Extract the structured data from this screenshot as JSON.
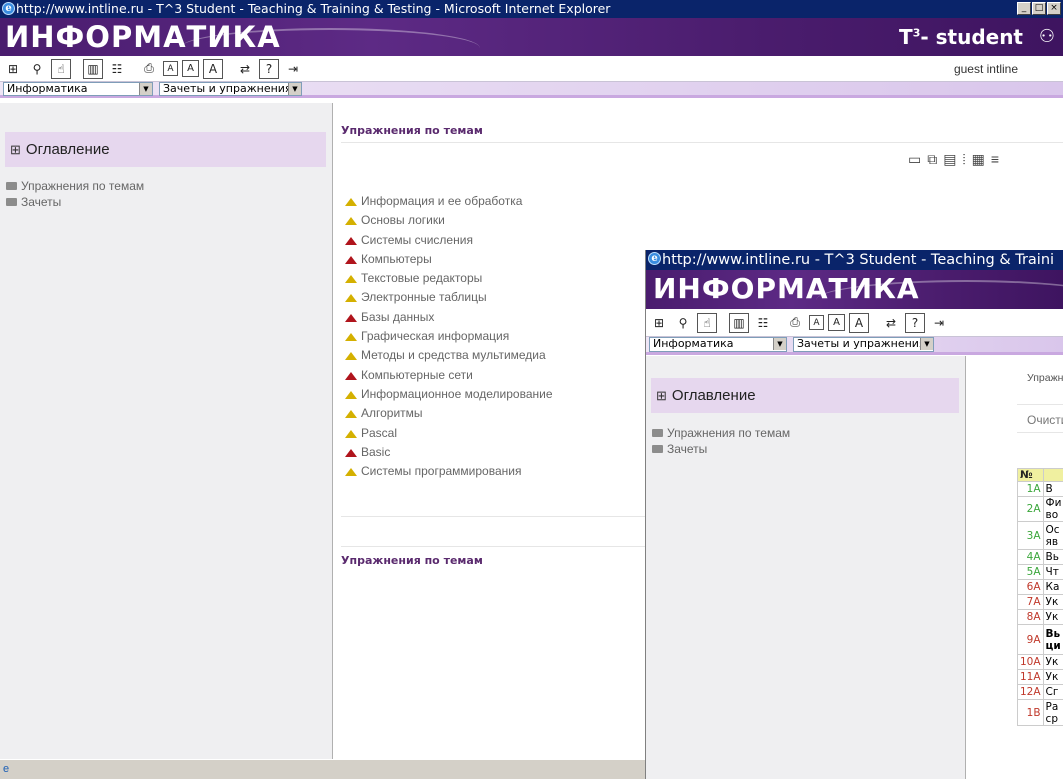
{
  "main_window": {
    "title": "http://www.intline.ru - T^3 Student - Teaching & Training & Testing - Microsoft Internet Explorer",
    "logo_text": "ИНФОРМАТИКА",
    "brand": "student",
    "brand_prefix": "T",
    "brand_sup": "3",
    "user": "guest intline",
    "subject_select": "Информатика",
    "section_select": "Зачеты и упражнения",
    "toc_title": "Оглавление",
    "tree": [
      "Упражнения по темам",
      "Зачеты"
    ],
    "section_title": "Упражнения по темам",
    "topics": [
      {
        "label": "Информация и ее обработка",
        "color": "yellow"
      },
      {
        "label": "Основы логики",
        "color": "yellow"
      },
      {
        "label": "Системы счисления",
        "color": "red"
      },
      {
        "label": "Компьютеры",
        "color": "red"
      },
      {
        "label": "Текстовые редакторы",
        "color": "yellow"
      },
      {
        "label": "Электронные таблицы",
        "color": "yellow"
      },
      {
        "label": "Базы данных",
        "color": "red"
      },
      {
        "label": "Графическая информация",
        "color": "yellow"
      },
      {
        "label": "Методы и средства мультимедиа",
        "color": "yellow"
      },
      {
        "label": "Компьютерные сети",
        "color": "red"
      },
      {
        "label": "Информационное моделирование",
        "color": "yellow"
      },
      {
        "label": "Алгоритмы",
        "color": "yellow"
      },
      {
        "label": "Pascal",
        "color": "yellow"
      },
      {
        "label": "Basic",
        "color": "red"
      },
      {
        "label": "Системы программирования",
        "color": "yellow"
      }
    ],
    "footer_title": "Упражнения по темам"
  },
  "second_window": {
    "title": "http://www.intline.ru - T^3 Student - Teaching & Traini",
    "logo_text": "ИНФОРМАТИКА",
    "subject_select": "Информатика",
    "section_select": "Зачеты и упражнения",
    "toc_title": "Оглавление",
    "tree": [
      "Упражнения по темам",
      "Зачеты"
    ],
    "section_title_partial": "Упражн",
    "clear_partial": "Очисти",
    "table_header": [
      "№",
      ""
    ],
    "rows": [
      {
        "num": "1А",
        "text": "В",
        "tone": "green",
        "tall": false
      },
      {
        "num": "2А",
        "text": "Фи во",
        "tone": "green",
        "tall": true
      },
      {
        "num": "3А",
        "text": "Ос яв",
        "tone": "green",
        "tall": true
      },
      {
        "num": "4А",
        "text": "Вь",
        "tone": "green",
        "tall": false
      },
      {
        "num": "5А",
        "text": "Чт",
        "tone": "green",
        "tall": false
      },
      {
        "num": "6А",
        "text": "Ка",
        "tone": "red",
        "tall": false
      },
      {
        "num": "7А",
        "text": "Ук",
        "tone": "red",
        "tall": false
      },
      {
        "num": "8А",
        "text": "Ук",
        "tone": "red",
        "tall": false
      },
      {
        "num": "9А",
        "text": "Вь ци",
        "tone": "red",
        "tall": true
      },
      {
        "num": "10А",
        "text": "Ук",
        "tone": "red",
        "tall": false
      },
      {
        "num": "11А",
        "text": "Ук",
        "tone": "red",
        "tall": false
      },
      {
        "num": "12А",
        "text": "Сг",
        "tone": "red",
        "tall": false
      },
      {
        "num": "1В",
        "text": "Ра ср",
        "tone": "red",
        "tall": true
      }
    ]
  },
  "colors": {
    "banner": "#4a1c6e",
    "title_bar": "#0a246a",
    "section_title": "#5a2a6e",
    "tri_yellow": "#d4b000",
    "tri_red": "#b0141c"
  }
}
